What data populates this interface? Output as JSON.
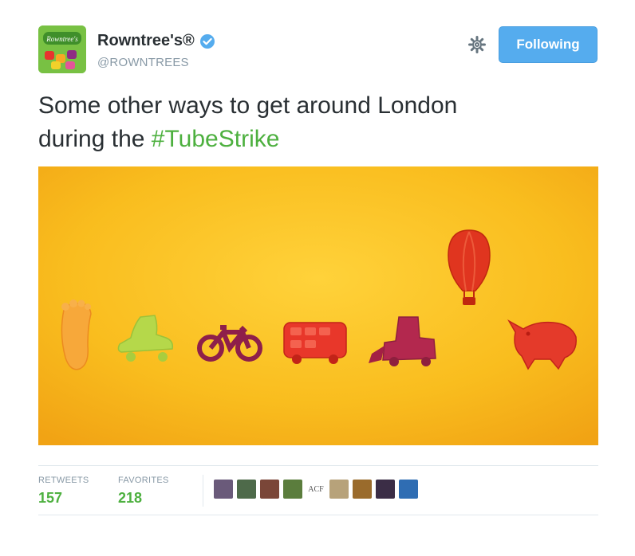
{
  "account": {
    "display_name": "Rowntree's®",
    "handle": "@ROWNTREES",
    "avatar_icon": "rowntrees-logo-icon"
  },
  "header": {
    "follow_button_label": "Following",
    "settings_icon": "gear-icon"
  },
  "tweet": {
    "text_line1": "Some other ways to get around London",
    "text_line2_prefix": "during the ",
    "hashtag": "#TubeStrike"
  },
  "media": {
    "description_icons": [
      "foot-icon",
      "roller-skate-icon",
      "bicycle-icon",
      "bus-icon",
      "digger-icon",
      "hot-air-balloon-icon",
      "rhino-icon"
    ]
  },
  "stats": {
    "retweets_label": "RETWEETS",
    "retweets_count": "157",
    "favorites_label": "FAVORITES",
    "favorites_count": "218"
  },
  "favoriters": {
    "initials_avatar_text": "ACF"
  },
  "colors": {
    "brand_blue": "#55acee",
    "hashtag_green": "#4db03f",
    "media_yellow": "#f6b81d"
  }
}
